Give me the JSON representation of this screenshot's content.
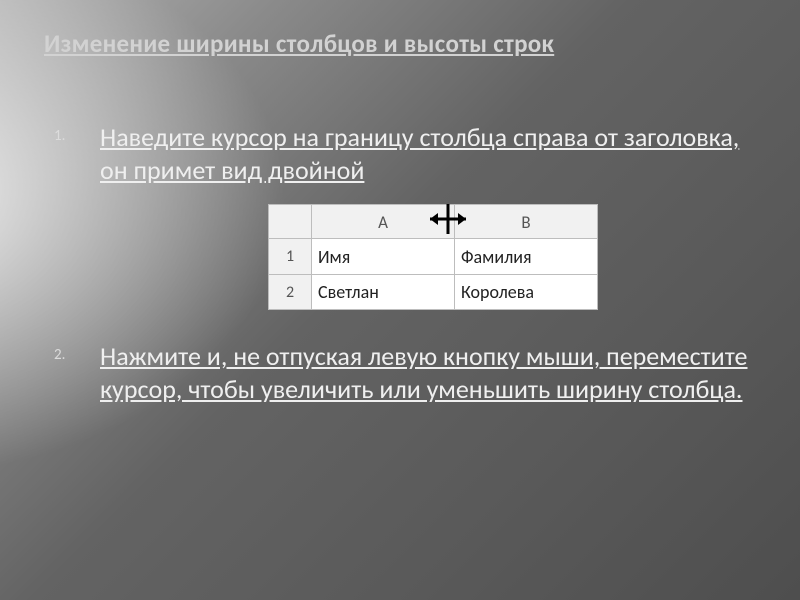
{
  "title": "Изменение ширины столбцов и высоты строк",
  "steps": [
    "Наведите курсор на границу столбца справа от заголовка, он примет вид двойной",
    "Нажмите и, не отпуская левую кнопку мыши, переместите курсор, чтобы увеличить или уменьшить ширину столбца."
  ],
  "figure": {
    "col_headers": [
      "A",
      "B"
    ],
    "row_headers": [
      "1",
      "2"
    ],
    "rows": [
      [
        "Имя",
        "Фамилия"
      ],
      [
        "Светлан",
        "Королева"
      ]
    ],
    "cursor_icon": "resize-horizontal-icon"
  }
}
